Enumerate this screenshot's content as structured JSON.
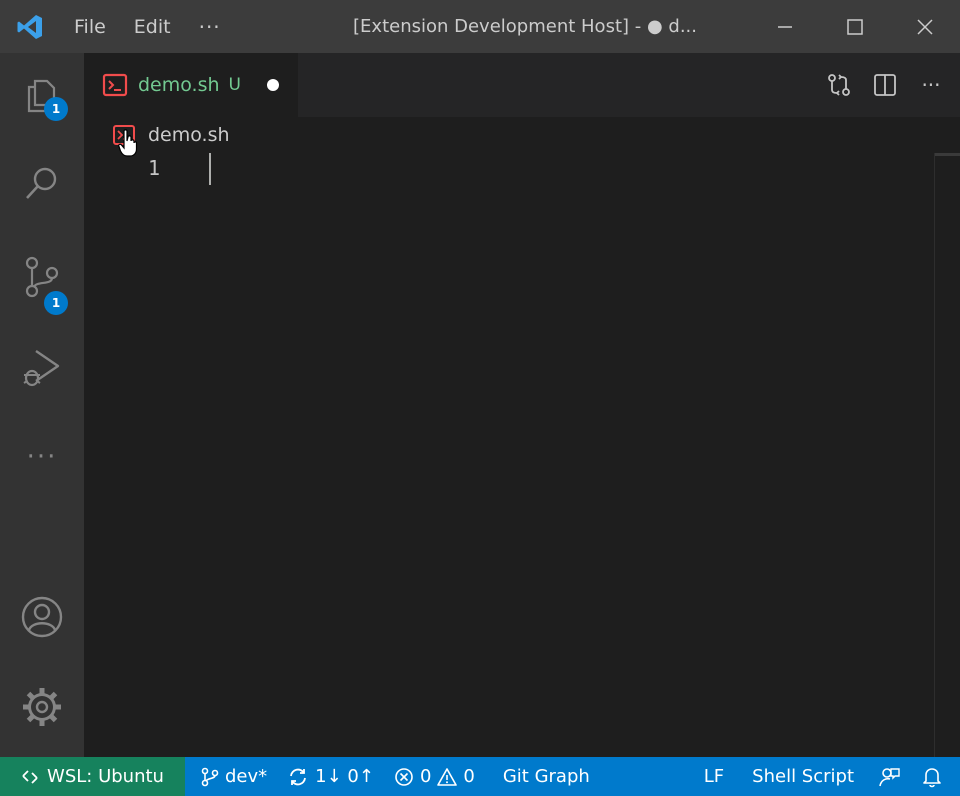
{
  "titlebar": {
    "menu": [
      "File",
      "Edit"
    ],
    "more": "···",
    "window_title": "[Extension Development Host] - ● d..."
  },
  "activity": {
    "explorer_badge": "1",
    "scm_badge": "1",
    "more": "···"
  },
  "editor": {
    "tab": {
      "label": "demo.sh",
      "status": "U"
    },
    "breadcrumb": "demo.sh",
    "line_number": "1"
  },
  "statusbar": {
    "remote": "WSL: Ubuntu",
    "branch": "dev*",
    "sync": "1↓ 0↑",
    "errors": "0",
    "warnings": "0",
    "git_graph": "Git Graph",
    "eol": "LF",
    "language": "Shell Script"
  },
  "colors": {
    "accent": "#007acc",
    "remote": "#16825d",
    "git_untracked": "#73c991",
    "shell_icon": "#f14c4c"
  }
}
